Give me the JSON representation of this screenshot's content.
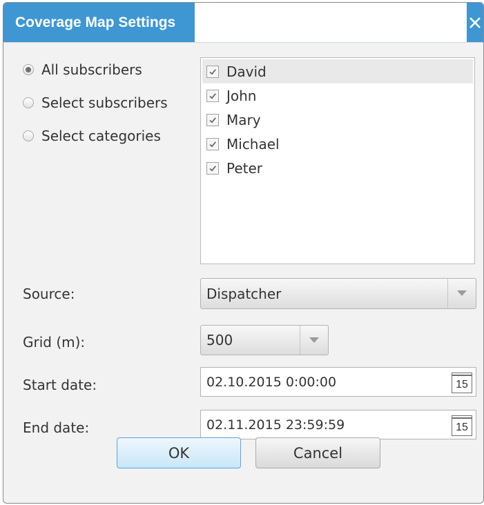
{
  "window": {
    "title": "Coverage Map Settings",
    "close_icon": "close-icon"
  },
  "selection_mode": {
    "options": [
      {
        "label": "All subscribers",
        "checked": true
      },
      {
        "label": "Select subscribers",
        "checked": false
      },
      {
        "label": "Select categories",
        "checked": false
      }
    ]
  },
  "subscribers": {
    "items": [
      {
        "label": "David",
        "checked": true
      },
      {
        "label": "John",
        "checked": true
      },
      {
        "label": "Mary",
        "checked": true
      },
      {
        "label": "Michael",
        "checked": true
      },
      {
        "label": "Peter",
        "checked": true
      }
    ]
  },
  "form": {
    "source": {
      "label": "Source:",
      "value": "Dispatcher"
    },
    "grid": {
      "label": "Grid (m):",
      "value": "500"
    },
    "start_date": {
      "label": "Start date:",
      "value": "02.10.2015 0:00:00",
      "calendar_day": "15"
    },
    "end_date": {
      "label": "End date:",
      "value": "02.11.2015 23:59:59",
      "calendar_day": "15"
    }
  },
  "buttons": {
    "ok": "OK",
    "cancel": "Cancel"
  },
  "colors": {
    "title_bar": "#3e97d3",
    "dialog_background": "#f2f2f2",
    "ok_button_border": "#58a6d8"
  }
}
